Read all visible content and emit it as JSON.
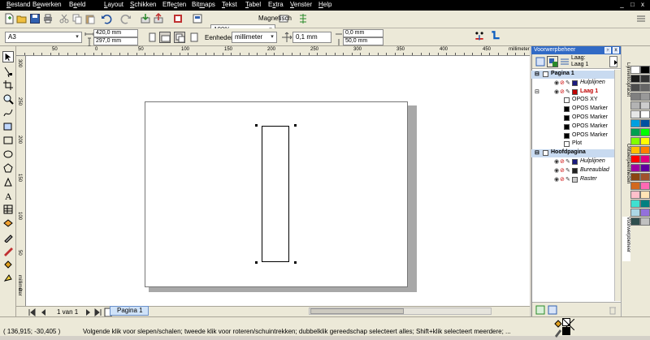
{
  "menu": [
    {
      "label": "Bestand",
      "key": "B"
    },
    {
      "label": "Bewerken",
      "key": "e"
    },
    {
      "label": "Beeld",
      "key": "e"
    },
    {
      "label": "Layout",
      "key": "L"
    },
    {
      "label": "Schikken",
      "key": "S"
    },
    {
      "label": "Effecten",
      "key": "c"
    },
    {
      "label": "Bitmaps",
      "key": "m"
    },
    {
      "label": "Tekst",
      "key": "T"
    },
    {
      "label": "Tabel",
      "key": "T"
    },
    {
      "label": "Extra",
      "key": "x"
    },
    {
      "label": "Venster",
      "key": "V"
    },
    {
      "label": "Help",
      "key": "H"
    }
  ],
  "window_controls": "_ □ x",
  "standard_toolbar": {
    "zoom": "100%",
    "snap": "Magnetisch"
  },
  "property_bar": {
    "paper_size": "A3",
    "width": "420,0 mm",
    "height": "297,0 mm",
    "units_label": "Eenheden:",
    "units": "millimeter",
    "nudge": "0,1 mm",
    "dup_x": "0,0 mm",
    "dup_y": "50,0 mm"
  },
  "ruler": {
    "h_ticks": [
      "50",
      "0",
      "50",
      "100",
      "150",
      "200",
      "250",
      "300",
      "350",
      "400",
      "450"
    ],
    "h_unit": "millimeter",
    "v_ticks": [
      "300",
      "250",
      "200",
      "150",
      "100",
      "50",
      "0"
    ],
    "v_unit": "millimeter"
  },
  "page_nav": {
    "count": "1 van 1",
    "tab": "Pagina 1"
  },
  "status": {
    "coords": "( 136,915; -30,405 )",
    "hint": "Volgende klik voor slepen/schalen; tweede klik voor roteren/schuintrekken; dubbelklik gereedschap selecteert alles; Shift+klik selecteert meerdere; ..."
  },
  "docker": {
    "title": "Voorwerpbeheer",
    "layer_label": "Laag:",
    "layer_value": "Laag 1",
    "tree": [
      {
        "label": "Pagina 1",
        "header": true,
        "color": "#000000"
      },
      {
        "label": "Hulplijnen",
        "italic": true,
        "color": "#000000",
        "swatch": "#1a1a80"
      },
      {
        "label": "Laag 1",
        "active": true,
        "color": "#c00000",
        "swatch": "#c00000"
      },
      {
        "label": "OPOS XY",
        "color": "#000000",
        "swatch": "#ffffff"
      },
      {
        "label": "OPOS Marker",
        "color": "#000000",
        "swatch": "#000000"
      },
      {
        "label": "OPOS Marker",
        "color": "#000000",
        "swatch": "#000000"
      },
      {
        "label": "OPOS Marker",
        "color": "#000000",
        "swatch": "#000000"
      },
      {
        "label": "OPOS Marker",
        "color": "#000000",
        "swatch": "#000000"
      },
      {
        "label": "Plot",
        "color": "#000000",
        "swatch": "#ffffff"
      },
      {
        "label": "Hoofdpagina",
        "header": true,
        "color": "#000000"
      },
      {
        "label": "Hulplijnen",
        "italic": true,
        "color": "#000000",
        "swatch": "#1a1a80"
      },
      {
        "label": "Bureaublad",
        "italic": true,
        "color": "#000000",
        "swatch": "#222222"
      },
      {
        "label": "Raster",
        "italic": true,
        "color": "#000000",
        "swatch": "#cccccc"
      }
    ]
  },
  "side_tabs": [
    "Lijnverloopfacet",
    "Ontwerpeenheden",
    "Voorwerpbeheer"
  ],
  "palette": [
    "#ffffff",
    "#000000",
    "#1a1a1a",
    "#333333",
    "#4d4d4d",
    "#666666",
    "#808080",
    "#999999",
    "#b3b3b3",
    "#cccccc",
    "#e6e6e6",
    "#ffffff",
    "#00a0e0",
    "#0050a0",
    "#00a050",
    "#00ff00",
    "#80ff00",
    "#ffff00",
    "#ffc000",
    "#ff8000",
    "#ff0000",
    "#e00080",
    "#a000a0",
    "#6000a0",
    "#8b4513",
    "#a0522d",
    "#d2691e",
    "#ff69b4",
    "#ffc0cb",
    "#ffe4b5",
    "#40e0d0",
    "#008080",
    "#add8e6",
    "#9370db",
    "#2f4f4f",
    "#c0c0c0"
  ],
  "colors": {
    "menubar": "#000000",
    "accent": "#316ac5",
    "page_tab": "#cfe2f8",
    "layer_active": "#c00000"
  }
}
